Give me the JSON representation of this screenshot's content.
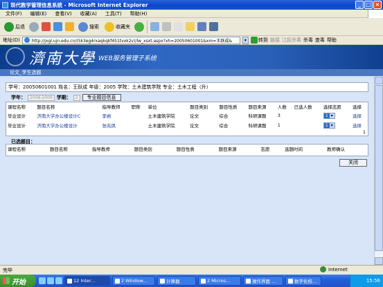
{
  "window": {
    "title": "现代教学管理信息系统 - Microsoft Internet Explorer",
    "controls": [
      "_",
      "□",
      "×"
    ]
  },
  "menu": [
    "文件(F)",
    "编辑(E)",
    "查看(V)",
    "收藏(A)",
    "工具(T)",
    "帮助(H)"
  ],
  "toolbar": {
    "back": "后退",
    "search": "搜索",
    "favorites": "收藏夹"
  },
  "address": {
    "label": "地址(D)",
    "url": "http://jxgl.ujn.edu.cn/(5k3eg4rxaqkqkf451tvxk2v)/lw_xsxt.aspx?xh=20050601001&xm=王跃成&",
    "go": "转到",
    "links": "链接",
    "jiangmin": "江民杀毒",
    "kill": "杀毒",
    "lookup": "查毒",
    "help": "帮助"
  },
  "banner": {
    "logo": "濟南大學",
    "subtitle": "WEB服务管理子系统"
  },
  "breadcrumb": "论文_学生选题",
  "student": {
    "info": "学号：20050601001  姓名：王跃成  年级：2005  学院：土木建筑学院  专业：土木工程（升）"
  },
  "filters": {
    "year_label": "学年：",
    "year_value": "2008-2009",
    "term_label": "学期：",
    "term_value": "2",
    "query_button": "专业题目信息"
  },
  "topics": {
    "headers": [
      "课程名称",
      "题目名称",
      "指导教师",
      "职称",
      "单位",
      "题目类别",
      "题目性质",
      "题目来源",
      "人数",
      "已选人数",
      "选择志愿",
      "选择"
    ],
    "rows": [
      {
        "course": "毕业设计",
        "title": "济南大学办公楼设计C",
        "teacher": "李岩",
        "rank": "",
        "unit": "土木建筑学院",
        "category": "论文",
        "nature": "综合",
        "source": "科研课题",
        "count": "3",
        "selected": "",
        "wish": "1",
        "action": "选择"
      },
      {
        "course": "毕业设计",
        "title": "济南大学办公楼设计",
        "teacher": "张兆凤",
        "rank": "",
        "unit": "土木建筑学院",
        "category": "论文",
        "nature": "综合",
        "source": "科研课题",
        "count": "1",
        "selected": "",
        "wish": "1",
        "action": "选择"
      }
    ],
    "page": "1"
  },
  "selected_topics": {
    "title": "已选题目：",
    "headers": [
      "课程名称",
      "题目名称",
      "指导教师",
      "题目类别",
      "题目性质",
      "题目来源",
      "志愿",
      "选题时间",
      "教师确认"
    ]
  },
  "close_button": "关闭",
  "status": {
    "text": "完毕",
    "zone": "Internet"
  },
  "taskbar": {
    "start": "开始",
    "tasks": [
      "12 Inter...",
      "2 Window...",
      "计算器",
      "2 Micros...",
      "操作界面 ...",
      "数字化校..."
    ],
    "clock": "15:56"
  }
}
